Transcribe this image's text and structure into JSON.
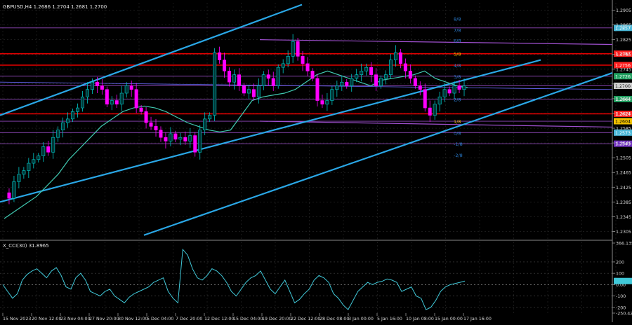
{
  "window": {
    "symbol_header": "GBPUSD,H4  1.2686 1.2704 1.2681 1.2700",
    "indicator_header": "X_CCI(30) 31.8965"
  },
  "main_axis": {
    "ticks": [
      "1.2905",
      "1.2865",
      "1.2825",
      "1.2785",
      "1.2745",
      "1.2705",
      "1.2665",
      "1.2625",
      "1.2585",
      "1.2545",
      "1.2505",
      "1.2465",
      "1.2425",
      "1.2385",
      "1.2345",
      "1.2305"
    ],
    "tag_texts": [
      "1.2857",
      "1.2787",
      "1.2756",
      "1.2726",
      "1.2700",
      "1.2664",
      "1.2624",
      "1.2604",
      "1.2573",
      "1.2543"
    ]
  },
  "indicator_axis": {
    "ticks": [
      "366.1356",
      "200",
      "100",
      "0.00",
      "-100",
      "-200",
      "-250.4230"
    ]
  },
  "murrey_labels": [
    "8/8",
    "7/8",
    "6/8",
    "5/8",
    "4/8",
    "3/8",
    "2/8",
    "1/8",
    "0/8",
    "-1/8",
    "-2/8"
  ],
  "time_axis": [
    "15 Nov 2023",
    "20 Nov 12:00",
    "23 Nov 04:00",
    "27 Nov 20:00",
    "30 Nov 12:00",
    "5 Dec 04:00",
    "7 Dec 20:00",
    "12 Dec 12:00",
    "15 Dec 04:00",
    "19 Dec 20:00",
    "22 Dec 12:00",
    "28 Dec 08:00",
    "3 Jan 00:00",
    "5 Jan 16:00",
    "10 Jan 08:00",
    "15 Jan 00:00",
    "17 Jan 16:00"
  ],
  "colors": {
    "background": "#000000",
    "candle_up": "#00c8c8",
    "candle_down": "#ff00ff",
    "channel": "#2aa7e6",
    "level_red": "#ff0000",
    "murrey_purple": "#a050d0",
    "ma": "#40c8b0",
    "cci": "#40c8d8"
  },
  "chart_data": {
    "type": "candlestick",
    "symbol": "GBPUSD",
    "timeframe": "H4",
    "last": {
      "open": 1.2686,
      "high": 1.2704,
      "low": 1.2681,
      "close": 1.27
    },
    "ylim": [
      1.2285,
      1.2925
    ],
    "x_range_dates": [
      "2023-11-15",
      "2024-01-19"
    ],
    "trend_channel_points": [
      [
        1.262,
        1.292
      ],
      [
        1.2385,
        1.277
      ],
      [
        1.2295,
        1.2735
      ]
    ],
    "horizontal_levels": [
      1.2857,
      1.2787,
      1.2756,
      1.2726,
      1.27,
      1.2664,
      1.2624,
      1.2604,
      1.2573,
      1.2543
    ],
    "price_path": [
      1.241,
      1.2395,
      1.244,
      1.246,
      1.247,
      1.249,
      1.25,
      1.251,
      1.2535,
      1.252,
      1.256,
      1.258,
      1.26,
      1.261,
      1.263,
      1.264,
      1.267,
      1.269,
      1.271,
      1.27,
      1.269,
      1.265,
      1.266,
      1.265,
      1.268,
      1.27,
      1.269,
      1.264,
      1.263,
      1.26,
      1.259,
      1.258,
      1.256,
      1.255,
      1.257,
      1.2555,
      1.256,
      1.255,
      1.2565,
      1.252,
      1.258,
      1.261,
      1.262,
      1.279,
      1.277,
      1.274,
      1.271,
      1.273,
      1.27,
      1.268,
      1.269,
      1.267,
      1.27,
      1.273,
      1.272,
      1.27,
      1.275,
      1.276,
      1.278,
      1.282,
      1.278,
      1.276,
      1.274,
      1.272,
      1.266,
      1.265,
      1.266,
      1.269,
      1.27,
      1.271,
      1.27,
      1.272,
      1.273,
      1.274,
      1.275,
      1.273,
      1.27,
      1.272,
      1.273,
      1.277,
      1.279,
      1.276,
      1.274,
      1.272,
      1.27,
      1.269,
      1.264,
      1.262,
      1.265,
      1.267,
      1.269,
      1.268,
      1.27,
      1.269,
      1.27
    ],
    "ma_path": [
      1.234,
      1.236,
      1.238,
      1.24,
      1.243,
      1.246,
      1.25,
      1.253,
      1.256,
      1.259,
      1.261,
      1.263,
      1.264,
      1.2645,
      1.264,
      1.263,
      1.2615,
      1.26,
      1.259,
      1.258,
      1.2575,
      1.258,
      1.262,
      1.266,
      1.267,
      1.2675,
      1.268,
      1.269,
      1.271,
      1.273,
      1.274,
      1.273,
      1.272,
      1.271,
      1.27,
      1.2715,
      1.272,
      1.2725,
      1.273,
      1.274,
      1.272,
      1.271,
      1.27,
      1.2695
    ],
    "cci": {
      "period": 30,
      "last": 31.8965,
      "ylim": [
        -250.423,
        366.1356
      ],
      "values": [
        0,
        -60,
        -120,
        -80,
        40,
        90,
        120,
        140,
        100,
        60,
        120,
        150,
        80,
        -20,
        -40,
        60,
        100,
        40,
        -60,
        -80,
        -100,
        -60,
        -40,
        -100,
        -130,
        -160,
        -110,
        -80,
        -60,
        -40,
        -20,
        20,
        40,
        60,
        -60,
        -120,
        -160,
        310,
        260,
        140,
        60,
        40,
        80,
        140,
        120,
        80,
        20,
        -60,
        -100,
        -40,
        20,
        60,
        80,
        120,
        40,
        -40,
        -80,
        -20,
        40,
        -60,
        -160,
        -130,
        -80,
        -40,
        40,
        80,
        60,
        20,
        -80,
        -120,
        -180,
        -220,
        -140,
        -60,
        -20,
        20,
        0,
        20,
        30,
        50,
        40,
        20,
        -60,
        -40,
        -20,
        -100,
        -120,
        -220,
        -200,
        -140,
        -60,
        -20,
        0,
        10,
        20,
        31.9
      ]
    }
  }
}
